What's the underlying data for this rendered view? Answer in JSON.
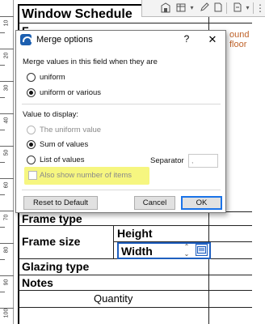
{
  "ruler": {
    "numbers": [
      "10",
      "20",
      "30",
      "40",
      "50",
      "60",
      "70",
      "80",
      "90",
      "100"
    ]
  },
  "schedule": {
    "title": "Window Schedule",
    "partial_top_row": "F",
    "ground_floor_label": "ound floor",
    "rows": {
      "frame_type": "Frame type",
      "frame_size": "Frame size",
      "height": "Height",
      "width": "Width",
      "glazing_type": "Glazing type",
      "notes": "Notes",
      "quantity": "Quantity"
    }
  },
  "toolbar": {
    "icons": [
      "building-icon",
      "schedule-icon",
      "dropdown-icon",
      "pen-icon",
      "page-icon",
      "dropdown-icon",
      "more-icon"
    ]
  },
  "dialog": {
    "title": "Merge options",
    "help": "?",
    "close": "✕",
    "merge_prompt": "Merge values in this field when they are",
    "option_uniform": "uniform",
    "option_uniform_or_various": "uniform or various",
    "value_to_display": "Value to display:",
    "option_uniform_value": "The uniform value",
    "option_sum": "Sum of values",
    "option_list": "List of values",
    "separator_label": "Separator",
    "separator_value": ",",
    "show_number_label": "Also show number of items",
    "reset_button": "Reset to Default",
    "cancel_button": "Cancel",
    "ok_button": "OK"
  },
  "state": {
    "merge_selected": "uniform or various",
    "display_selected": "Sum of values",
    "show_number_checked": false
  },
  "colors": {
    "highlight": "#f5f56a",
    "accent": "#1a73e8",
    "ground_floor_text": "#c0632a"
  }
}
